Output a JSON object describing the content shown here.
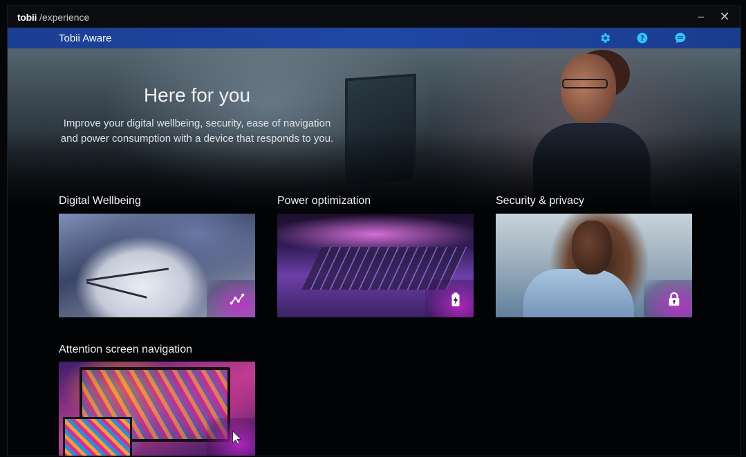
{
  "titlebar": {
    "brand": "tobii",
    "brand_sub": "/experience",
    "minimize_glyph": "–",
    "close_glyph": "✕"
  },
  "header": {
    "title": "Tobii Aware",
    "icons": [
      "gear-icon",
      "help-icon",
      "chat-icon"
    ],
    "icon_color": "#2ec5ff"
  },
  "hero": {
    "title": "Here for you",
    "text": "Improve your digital wellbeing, security, ease of navigation and power consumption with a device that responds to you."
  },
  "cards": [
    {
      "label": "Digital Wellbeing",
      "icon": "graph-nodes-icon"
    },
    {
      "label": "Power optimization",
      "icon": "battery-icon"
    },
    {
      "label": "Security & privacy",
      "icon": "lock-icon"
    },
    {
      "label": "Attention screen navigation",
      "icon": "cursor-icon"
    }
  ],
  "colors": {
    "appbar": "#1f48a4",
    "badge_accent": "#be28c8",
    "background": "#020305"
  }
}
